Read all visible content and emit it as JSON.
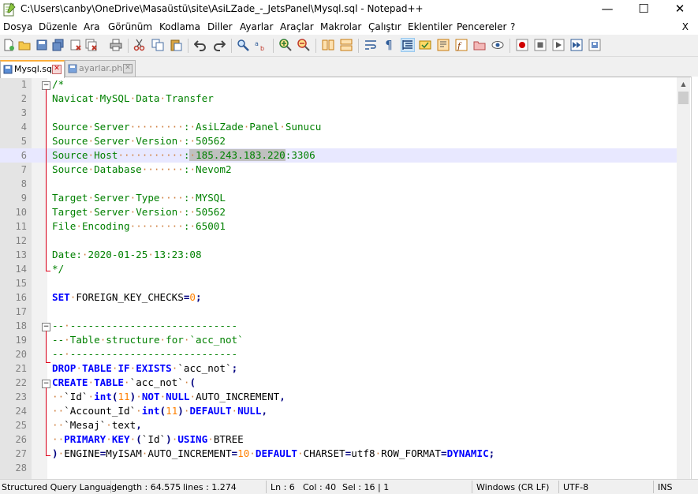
{
  "window": {
    "title": "C:\\Users\\canby\\OneDrive\\Masaüstü\\site\\AsiLZade_-_JetsPanel\\Mysql.sql - Notepad++",
    "minimize_glyph": "—",
    "maximize_glyph": "☐",
    "close_glyph": "✕"
  },
  "menu": {
    "items": [
      "Dosya",
      "Düzenle",
      "Ara",
      "Görünüm",
      "Kodlama",
      "Diller",
      "Ayarlar",
      "Araçlar",
      "Makrolar",
      "Çalıştır",
      "Eklentiler",
      "Pencereler",
      "?"
    ],
    "close_doc": "X"
  },
  "toolbar": {
    "icons": [
      "new-file-icon",
      "open-file-icon",
      "save-icon",
      "save-all-icon",
      "close-icon",
      "close-all-icon",
      "print-icon",
      "cut-icon",
      "copy-icon",
      "paste-icon",
      "undo-icon",
      "redo-icon",
      "find-icon",
      "replace-icon",
      "zoom-in-icon",
      "zoom-out-icon",
      "sync-vertical-icon",
      "sync-horizontal-icon",
      "word-wrap-icon",
      "show-all-chars-icon",
      "indent-guide-icon",
      "user-lang-icon",
      "doc-map-icon",
      "function-list-icon",
      "folder-workspace-icon",
      "monitoring-icon",
      "record-macro-icon",
      "stop-record-icon",
      "play-macro-icon",
      "play-multiple-icon",
      "save-macro-icon"
    ]
  },
  "tabs": [
    {
      "label": "Mysql.sql",
      "active": true
    },
    {
      "label": "ayarlar.php",
      "active": false
    }
  ],
  "editor": {
    "lines": [
      {
        "n": "1",
        "html": "<span class='c-com'>/*</span>"
      },
      {
        "n": "2",
        "html": "<span class='c-com'>Navicat<span class='c-dot'>·</span>MySQL<span class='c-dot'>·</span>Data<span class='c-dot'>·</span>Transfer</span>"
      },
      {
        "n": "3",
        "html": ""
      },
      {
        "n": "4",
        "html": "<span class='c-com'>Source<span class='c-dot'>·</span>Server<span class='c-dot'>·········</span>:<span class='c-dot'>·</span>AsiLZade<span class='c-dot'>·</span>Panel<span class='c-dot'>·</span>Sunucu</span>"
      },
      {
        "n": "5",
        "html": "<span class='c-com'>Source<span class='c-dot'>·</span>Server<span class='c-dot'>·</span>Version<span class='c-dot'>·</span>:<span class='c-dot'>·</span>50562</span>"
      },
      {
        "n": "6",
        "html": "<span class='c-com'>Source<span class='c-dot'>·</span>Host<span class='c-dot'>···········</span>:<span class='sel-text'><span class='c-dot'>·</span>185.243.183.220</span>:3306</span>"
      },
      {
        "n": "7",
        "html": "<span class='c-com'>Source<span class='c-dot'>·</span>Database<span class='c-dot'>·······</span>:<span class='c-dot'>·</span>Nevom2</span>"
      },
      {
        "n": "8",
        "html": ""
      },
      {
        "n": "9",
        "html": "<span class='c-com'>Target<span class='c-dot'>·</span>Server<span class='c-dot'>·</span>Type<span class='c-dot'>····</span>:<span class='c-dot'>·</span>MYSQL</span>"
      },
      {
        "n": "10",
        "html": "<span class='c-com'>Target<span class='c-dot'>·</span>Server<span class='c-dot'>·</span>Version<span class='c-dot'>·</span>:<span class='c-dot'>·</span>50562</span>"
      },
      {
        "n": "11",
        "html": "<span class='c-com'>File<span class='c-dot'>·</span>Encoding<span class='c-dot'>·········</span>:<span class='c-dot'>·</span>65001</span>"
      },
      {
        "n": "12",
        "html": ""
      },
      {
        "n": "13",
        "html": "<span class='c-com'>Date:<span class='c-dot'>·</span>2020-01-25<span class='c-dot'>·</span>13:23:08</span>"
      },
      {
        "n": "14",
        "html": "<span class='c-com'>*/</span>"
      },
      {
        "n": "15",
        "html": ""
      },
      {
        "n": "16",
        "html": "<span class='c-kw'>SET</span><span class='c-dot'>·</span>FOREIGN_KEY_CHECKS<span class='c-op'>=</span><span class='c-num'>0</span><span class='c-op'>;</span>"
      },
      {
        "n": "17",
        "html": ""
      },
      {
        "n": "18",
        "html": "<span class='c-com'>--<span class='c-dot'>·</span>----------------------------</span>"
      },
      {
        "n": "19",
        "html": "<span class='c-com'>--<span class='c-dot'>·</span>Table<span class='c-dot'>·</span>structure<span class='c-dot'>·</span>for<span class='c-dot'>·</span>`acc_not`</span>"
      },
      {
        "n": "20",
        "html": "<span class='c-com'>--<span class='c-dot'>·</span>----------------------------</span>"
      },
      {
        "n": "21",
        "html": "<span class='c-kw'>DROP</span><span class='c-dot'>·</span><span class='c-kw'>TABLE</span><span class='c-dot'>·</span><span class='c-kw'>IF</span><span class='c-dot'>·</span><span class='c-kw'>EXISTS</span><span class='c-dot'>·</span>`acc_not`<span class='c-op'>;</span>"
      },
      {
        "n": "22",
        "html": "<span class='c-kw'>CREATE</span><span class='c-dot'>·</span><span class='c-kw'>TABLE</span><span class='c-dot'>·</span>`acc_not`<span class='c-dot'>·</span><span class='c-op'>(</span>"
      },
      {
        "n": "23",
        "html": "<span class='c-dot'>··</span>`Id`<span class='c-dot'>·</span><span class='c-kw'>int</span><span class='c-op'>(</span><span class='c-num'>11</span><span class='c-op'>)</span><span class='c-dot'>·</span><span class='c-kw'>NOT</span><span class='c-dot'>·</span><span class='c-kw'>NULL</span><span class='c-dot'>·</span>AUTO_INCREMENT<span class='c-op'>,</span>"
      },
      {
        "n": "24",
        "html": "<span class='c-dot'>··</span>`Account_Id`<span class='c-dot'>·</span><span class='c-kw'>int</span><span class='c-op'>(</span><span class='c-num'>11</span><span class='c-op'>)</span><span class='c-dot'>·</span><span class='c-kw'>DEFAULT</span><span class='c-dot'>·</span><span class='c-kw'>NULL</span><span class='c-op'>,</span>"
      },
      {
        "n": "25",
        "html": "<span class='c-dot'>··</span>`Mesaj`<span class='c-dot'>·</span>text<span class='c-op'>,</span>"
      },
      {
        "n": "26",
        "html": "<span class='c-dot'>··</span><span class='c-kw'>PRIMARY</span><span class='c-dot'>·</span><span class='c-kw'>KEY</span><span class='c-dot'>·</span><span class='c-op'>(</span>`Id`<span class='c-op'>)</span><span class='c-dot'>·</span><span class='c-kw'>USING</span><span class='c-dot'>·</span>BTREE"
      },
      {
        "n": "27",
        "html": "<span class='c-op'>)</span><span class='c-dot'>·</span>ENGINE<span class='c-op'>=</span>MyISAM<span class='c-dot'>·</span>AUTO_INCREMENT<span class='c-op'>=</span><span class='c-num'>10</span><span class='c-dot'>·</span><span class='c-kw'>DEFAULT</span><span class='c-dot'>·</span>CHARSET<span class='c-op'>=</span>utf8<span class='c-dot'>·</span>ROW_FORMAT<span class='c-op'>=</span><span class='c-kw'>DYNAMIC</span><span class='c-op'>;</span>"
      },
      {
        "n": "28",
        "html": ""
      }
    ],
    "current_line": 6
  },
  "status": {
    "language": "Structured Query Language",
    "length": "length : 64.575",
    "lines": "lines : 1.274",
    "ln": "Ln : 6",
    "col": "Col : 40",
    "sel": "Sel : 16 | 1",
    "eol": "Windows (CR LF)",
    "encoding": "UTF-8",
    "ins": "INS"
  }
}
